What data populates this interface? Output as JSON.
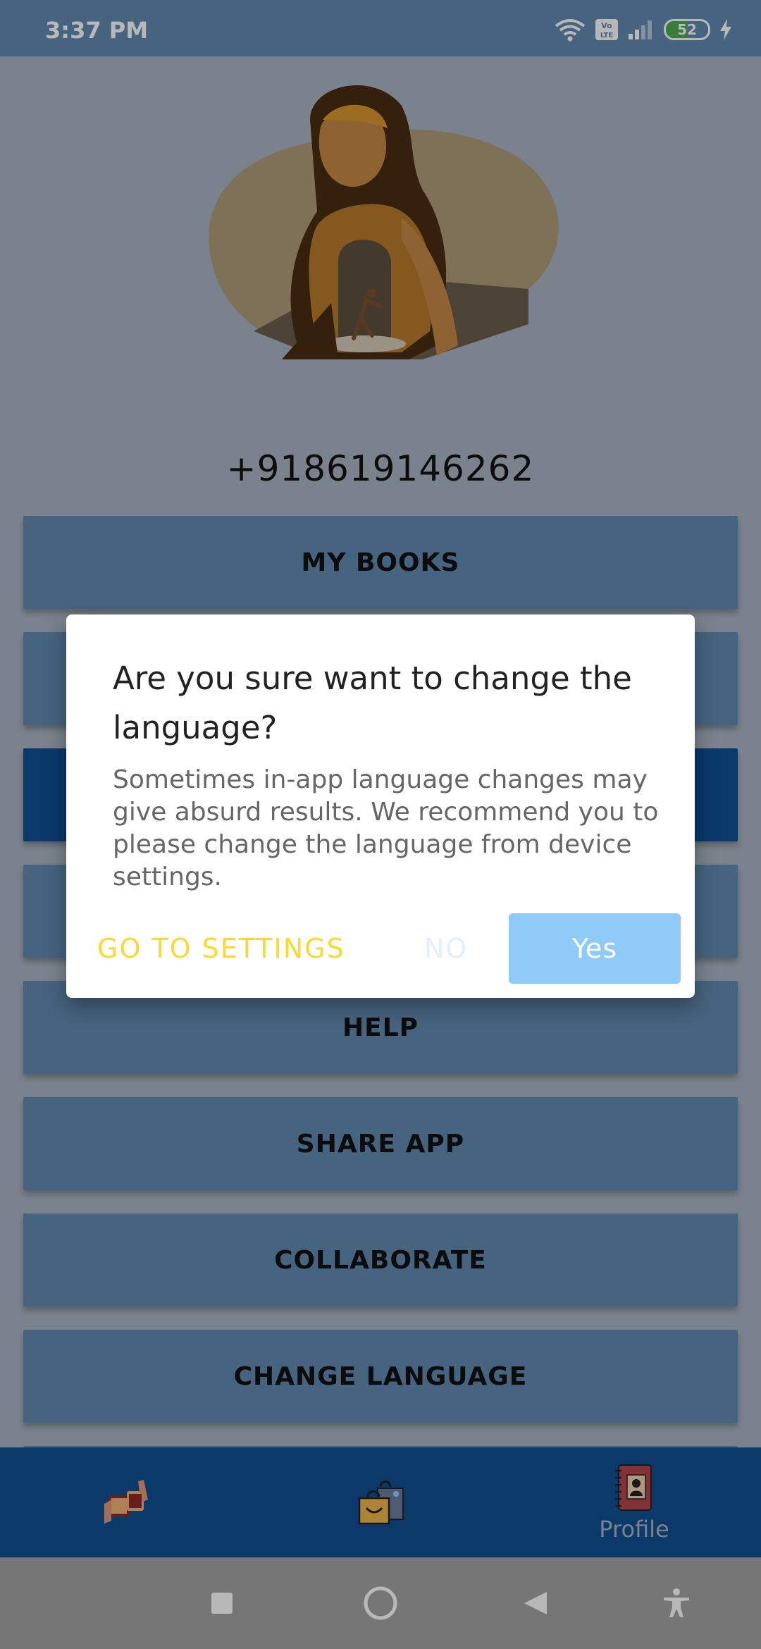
{
  "status_bar": {
    "time": "3:37 PM",
    "battery": "52",
    "battery_level": 0.52,
    "network_badge": "Vo LTE"
  },
  "profile": {
    "phone": "+918619146262"
  },
  "menu": {
    "items": [
      {
        "label": "MY BOOKS"
      },
      {
        "label": ""
      },
      {
        "label": ""
      },
      {
        "label": ""
      },
      {
        "label": "HELP"
      },
      {
        "label": "SHARE APP"
      },
      {
        "label": "COLLABORATE"
      },
      {
        "label": "CHANGE LANGUAGE"
      }
    ]
  },
  "dialog": {
    "title": "Are you sure want to change the language?",
    "message": "Sometimes in-app language changes may give absurd results. We recommend you to please change the language from device settings.",
    "settings_label": "GO TO SETTINGS",
    "no_label": "NO",
    "yes_label": "Yes"
  },
  "bottom_nav": {
    "items": [
      {
        "icon": "book-exchange-icon",
        "label": ""
      },
      {
        "icon": "shopping-bag-icon",
        "label": ""
      },
      {
        "icon": "profile-book-icon",
        "label": "Profile"
      }
    ]
  },
  "colors": {
    "primary": "#6189b1",
    "primary_dark": "#0f4f93",
    "dialog_accent": "#fdd835",
    "yes_button": "#90caf9"
  }
}
